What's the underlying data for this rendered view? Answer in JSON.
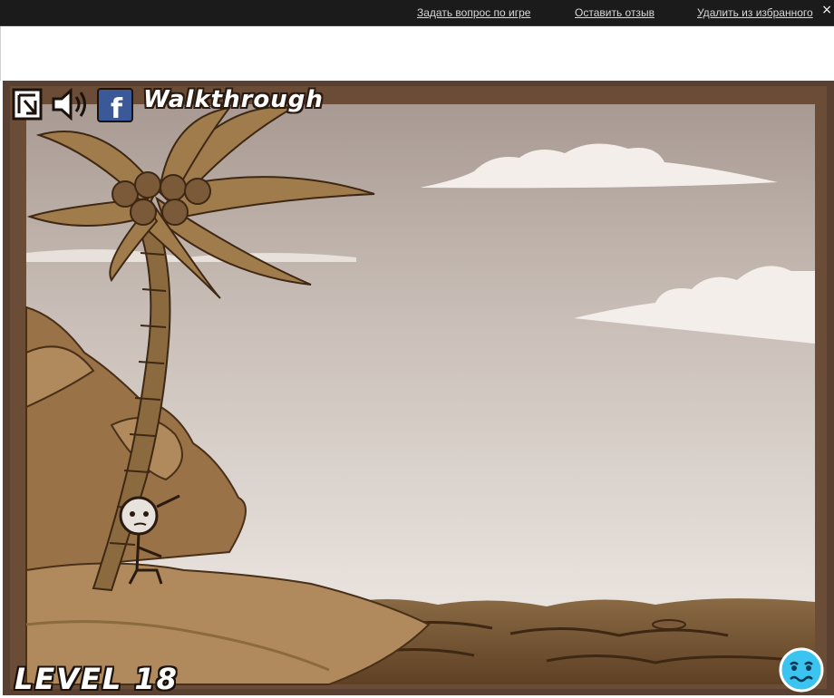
{
  "topbar": {
    "links": [
      "Задать вопрос по игре",
      "Оставить отзыв",
      "Удалить из избранного"
    ],
    "close": "×"
  },
  "hud": {
    "walkthrough": "Walkthrough",
    "icons": [
      "fullscreen-icon",
      "sound-icon",
      "facebook-icon"
    ],
    "facebook_letter": "f"
  },
  "level": {
    "label": "LEVEL 18"
  },
  "colors": {
    "frame": "#5a4030",
    "sky": "#d9cfc8",
    "sand": "#b08a5c",
    "sea": "#7a5a38",
    "palm": "#8a6a3e",
    "facebook": "#3b5998",
    "hint_face": "#3cc4f0"
  }
}
